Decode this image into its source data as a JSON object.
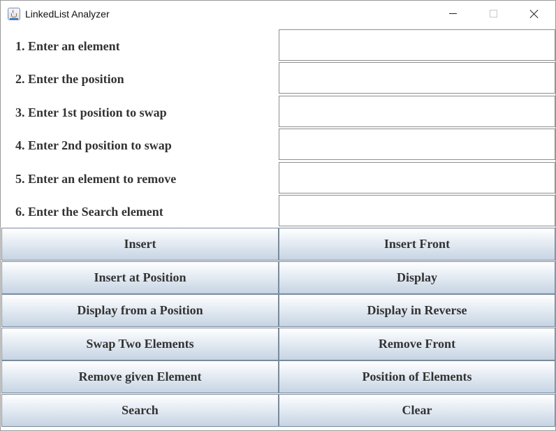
{
  "window": {
    "title": "LinkedList Analyzer",
    "icon": "java-cup-icon",
    "controls": [
      "minimize",
      "maximize",
      "close"
    ]
  },
  "form": {
    "fields": [
      {
        "label": "1. Enter an element",
        "value": ""
      },
      {
        "label": "2. Enter the position",
        "value": ""
      },
      {
        "label": "3. Enter 1st position to swap",
        "value": ""
      },
      {
        "label": "4. Enter 2nd position to swap",
        "value": ""
      },
      {
        "label": "5. Enter an element to remove",
        "value": ""
      },
      {
        "label": "6. Enter the Search element",
        "value": ""
      }
    ]
  },
  "buttons": {
    "insert": "Insert",
    "insert_front": "Insert Front",
    "insert_at_position": "Insert at Position",
    "display": "Display",
    "display_from_position": "Display from a Position",
    "display_in_reverse": "Display in Reverse",
    "swap_two_elements": "Swap Two Elements",
    "remove_front": "Remove Front",
    "remove_given_element": "Remove given Element",
    "position_of_elements": "Position of Elements",
    "search": "Search",
    "clear": "Clear"
  },
  "colors": {
    "button_top": "#ffffff",
    "button_bottom": "#c6d4e3",
    "button_border": "#7a8a9c",
    "label_text": "#333333"
  }
}
